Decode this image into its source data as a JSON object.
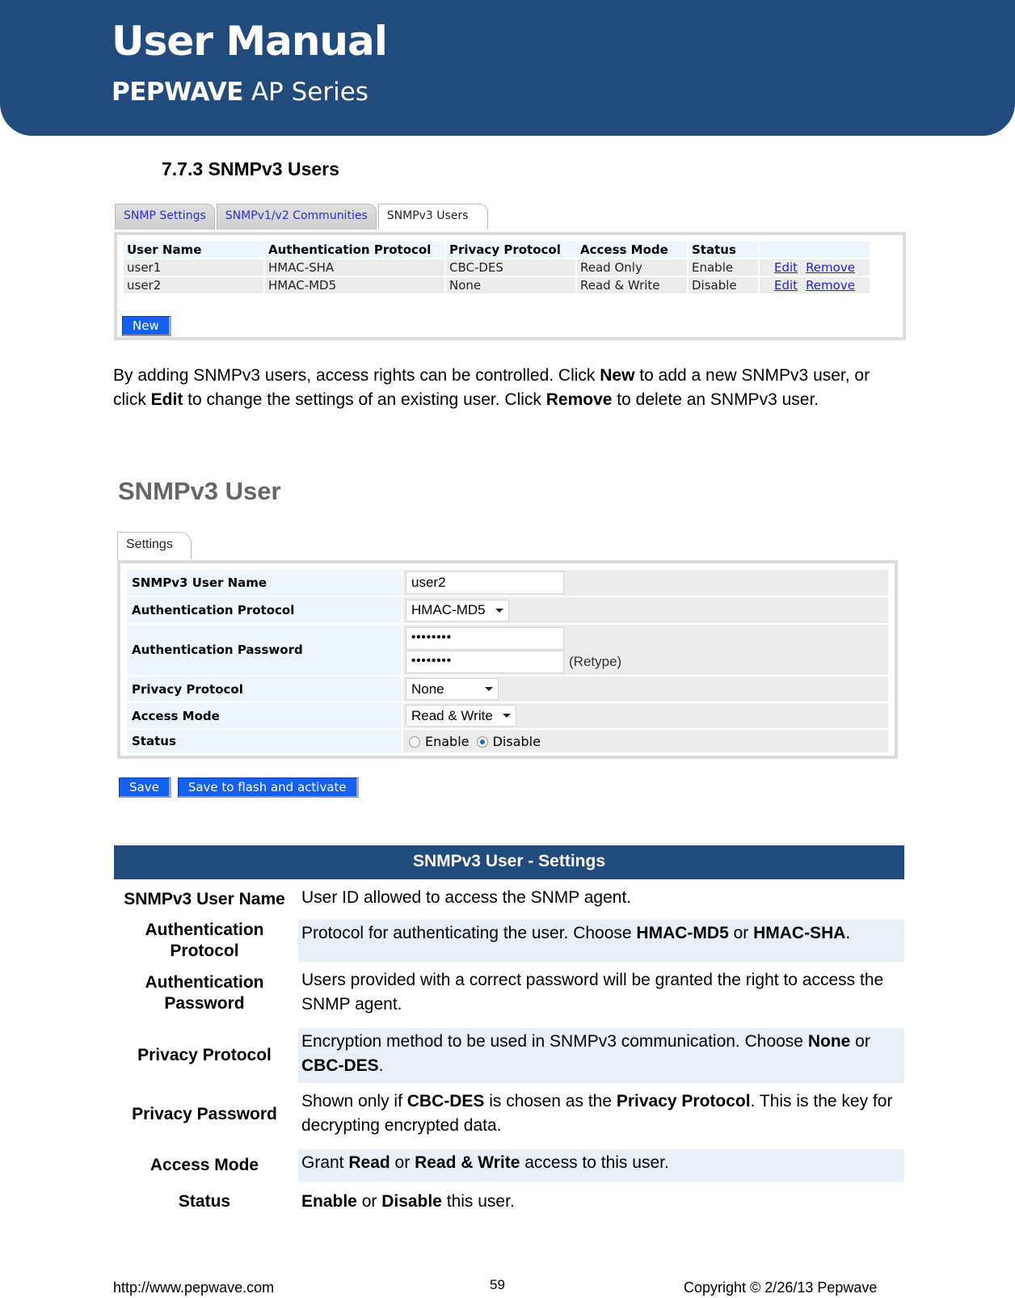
{
  "header": {
    "title": "User Manual",
    "brand": "PEPWAVE",
    "series": "AP Series",
    "banner_color": "#214a7d"
  },
  "section_heading": "7.7.3 SNMPv3 Users",
  "users_screen": {
    "tabs": [
      "SNMP Settings",
      "SNMPv1/v2 Communities",
      "SNMPv3 Users"
    ],
    "active_tab": "SNMPv3 Users",
    "columns": [
      "User Name",
      "Authentication Protocol",
      "Privacy Protocol",
      "Access Mode",
      "Status",
      ""
    ],
    "rows": [
      {
        "user_name": "user1",
        "auth_protocol": "HMAC-SHA",
        "privacy_protocol": "CBC-DES",
        "access_mode": "Read Only",
        "status": "Enable",
        "edit": "Edit",
        "remove": "Remove"
      },
      {
        "user_name": "user2",
        "auth_protocol": "HMAC-MD5",
        "privacy_protocol": "None",
        "access_mode": "Read & Write",
        "status": "Disable",
        "edit": "Edit",
        "remove": "Remove"
      }
    ],
    "new_button": "New"
  },
  "paragraph": {
    "p1": "By adding SNMPv3 users, access rights can be controlled. Click ",
    "b1": "New",
    "p2": " to add a new SNMPv3 user, or click ",
    "b2": "Edit",
    "p3": " to change the settings of an existing user. Click ",
    "b3": "Remove",
    "p4": " to delete an SNMPv3 user."
  },
  "form_screen": {
    "title": "SNMPv3 User",
    "tab": "Settings",
    "fields": {
      "user_name": {
        "label": "SNMPv3 User Name",
        "value": "user2"
      },
      "auth_protocol": {
        "label": "Authentication Protocol",
        "value": "HMAC-MD5"
      },
      "auth_password": {
        "label": "Authentication Password",
        "value": "••••••••",
        "retype_value": "••••••••",
        "retype_label": "(Retype)"
      },
      "privacy_protocol": {
        "label": "Privacy Protocol",
        "value": "None"
      },
      "access_mode": {
        "label": "Access Mode",
        "value": "Read & Write"
      },
      "status": {
        "label": "Status",
        "options": [
          "Enable",
          "Disable"
        ],
        "selected": "Disable"
      }
    },
    "save_button": "Save",
    "save_activate_button": "Save to flash and activate"
  },
  "settings_table": {
    "title": "SNMPv3 User - Settings",
    "rows": [
      {
        "key": "SNMPv3 User Name",
        "parts": [
          {
            "t": "User ID allowed to access the SNMP agent."
          }
        ]
      },
      {
        "key": "Authentication Protocol",
        "parts": [
          {
            "t": "Protocol for authenticating the user. Choose "
          },
          {
            "b": "HMAC-MD5"
          },
          {
            "t": " or "
          },
          {
            "b": "HMAC-SHA"
          },
          {
            "t": "."
          }
        ]
      },
      {
        "key": "Authentication Password",
        "parts": [
          {
            "t": "Users provided with a correct password will be granted the right to access the SNMP agent."
          }
        ]
      },
      {
        "key": "Privacy Protocol",
        "parts": [
          {
            "t": "Encryption method to be used in SNMPv3 communication. Choose "
          },
          {
            "b": "None"
          },
          {
            "t": " or "
          },
          {
            "b": "CBC-DES"
          },
          {
            "t": "."
          }
        ]
      },
      {
        "key": "Privacy Password",
        "parts": [
          {
            "t": "Shown only if "
          },
          {
            "b": "CBC-DES"
          },
          {
            "t": " is chosen as the "
          },
          {
            "b": "Privacy Protocol"
          },
          {
            "t": ". This is the key for decrypting encrypted data."
          }
        ]
      },
      {
        "key": "Access Mode",
        "parts": [
          {
            "t": "Grant "
          },
          {
            "b": "Read"
          },
          {
            "t": " or "
          },
          {
            "b": "Read & Write"
          },
          {
            "t": " access to this user."
          }
        ]
      },
      {
        "key": "Status",
        "parts": [
          {
            "b": "Enable"
          },
          {
            "t": " or "
          },
          {
            "b": "Disable"
          },
          {
            "t": " this user."
          }
        ]
      }
    ]
  },
  "footer": {
    "url": "http://www.pepwave.com",
    "page": "59",
    "copyright": "Copyright © 2/26/13 Pepwave"
  }
}
